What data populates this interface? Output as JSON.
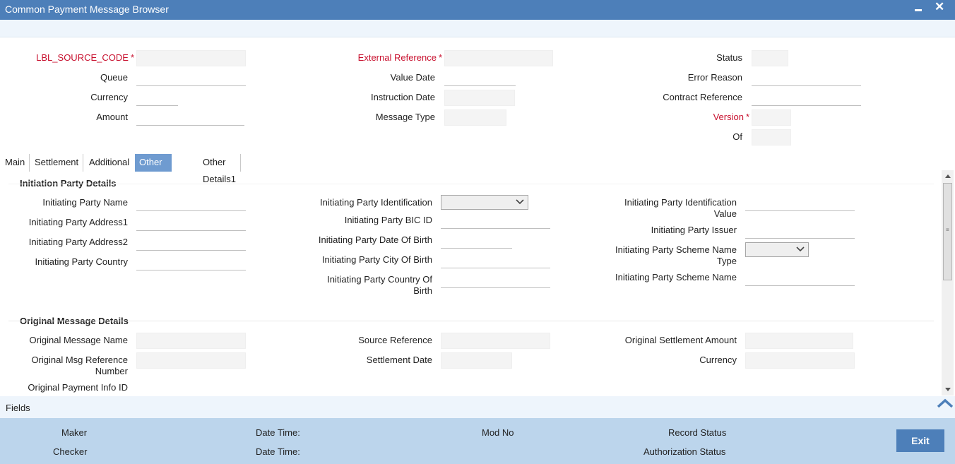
{
  "window": {
    "title": "Common Payment Message Browser",
    "minimize_label": "",
    "close_label": "✕"
  },
  "header": {
    "source_code_label": "LBL_SOURCE_CODE",
    "queue_label": "Queue",
    "currency_label": "Currency",
    "amount_label": "Amount",
    "external_reference_label": "External Reference",
    "value_date_label": "Value Date",
    "instruction_date_label": "Instruction Date",
    "message_type_label": "Message Type",
    "status_label": "Status",
    "error_reason_label": "Error Reason",
    "contract_reference_label": "Contract Reference",
    "version_label": "Version",
    "of_label": "Of",
    "required_marker": "*"
  },
  "tabs": [
    "Main",
    "Settlement",
    "Additional",
    "Other Details",
    "Other Details1"
  ],
  "active_tab": "Other Details",
  "initiation": {
    "title": "Initiation Party Details",
    "name_label": "Initiating Party Name",
    "address1_label": "Initiating Party Address1",
    "address2_label": "Initiating Party Address2",
    "country_label": "Initiating Party Country",
    "identification_label": "Initiating Party Identification",
    "bic_label": "Initiating Party BIC ID",
    "dob_label": "Initiating Party Date Of Birth",
    "city_of_birth_label": "Initiating Party City Of Birth",
    "country_of_birth_label": "Initiating Party Country Of Birth",
    "identification_value_label": "Initiating Party Identification Value",
    "issuer_label": "Initiating Party Issuer",
    "scheme_name_type_label": "Initiating Party Scheme Name Type",
    "scheme_name_label": "Initiating Party Scheme Name"
  },
  "original": {
    "title": "Original Message Details",
    "message_name_label": "Original Message Name",
    "msg_reference_label": "Original Msg Reference Number",
    "payment_info_label": "Original Payment Info ID",
    "source_reference_label": "Source Reference",
    "settlement_date_label": "Settlement Date",
    "settlement_amount_label": "Original Settlement Amount",
    "currency_label": "Currency"
  },
  "fields_bar": {
    "label": "Fields"
  },
  "footer": {
    "maker_label": "Maker",
    "checker_label": "Checker",
    "date_time_label_1": "Date Time:",
    "date_time_label_2": "Date Time:",
    "mod_no_label": "Mod No",
    "record_status_label": "Record Status",
    "authorization_status_label": "Authorization Status",
    "exit_label": "Exit"
  },
  "colors": {
    "title_bar": "#4d7fb9",
    "active_tab": "#6f9bd0",
    "required": "#c8102e",
    "footer": "#bcd5ec"
  }
}
